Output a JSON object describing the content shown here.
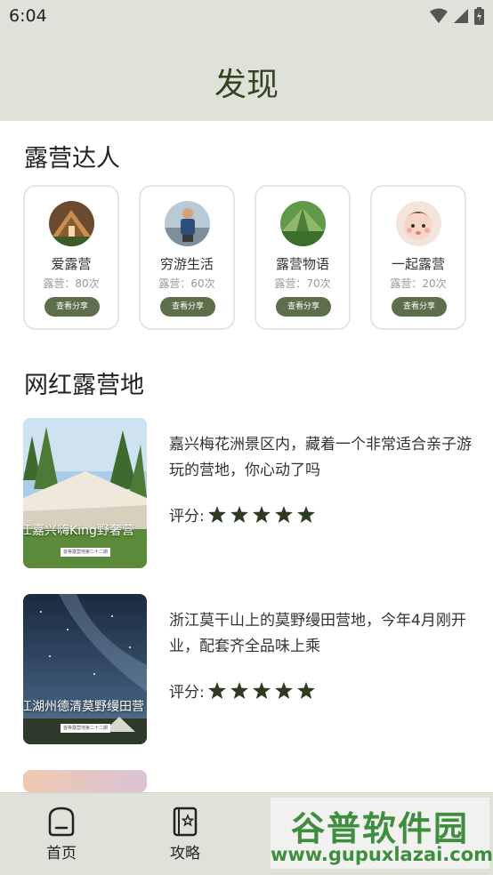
{
  "status_bar": {
    "time": "6:04"
  },
  "header": {
    "title": "发现"
  },
  "experts_section": {
    "title": "露营达人",
    "items": [
      {
        "name": "爱露营",
        "count": "露营：80次",
        "button": "查看分享"
      },
      {
        "name": "穷游生活",
        "count": "露营：60次",
        "button": "查看分享"
      },
      {
        "name": "露营物语",
        "count": "露营：70次",
        "button": "查看分享"
      },
      {
        "name": "一起露营",
        "count": "露营：20次",
        "button": "查看分享"
      }
    ]
  },
  "spots_section": {
    "title": "网红露营地",
    "items": [
      {
        "thumb_caption": "江嘉兴嗨King野奢营",
        "thumb_sub": "首等露营地第二十二期",
        "description": "嘉兴梅花洲景区内，藏着一个非常适合亲子游玩的营地，你心动了吗",
        "rating_label": "评分:",
        "rating": 5
      },
      {
        "thumb_caption": "江湖州德清莫野缦田营",
        "thumb_sub": "首等露营地第二十二期",
        "description": "浙江莫干山上的莫野缦田营地，今年4月刚开业，配套齐全品味上乘",
        "rating_label": "评分:",
        "rating": 5
      }
    ]
  },
  "bottom_nav": {
    "items": [
      {
        "label": "首页",
        "icon": "home-icon"
      },
      {
        "label": "攻略",
        "icon": "guide-icon"
      }
    ]
  },
  "watermark": {
    "title": "谷普软件园",
    "url": "www.gupuxlazai.com"
  },
  "colors": {
    "header_bg": "#dfe2d8",
    "accent": "#5c6e4a",
    "star": "#2f3a23",
    "title": "#37421f"
  }
}
